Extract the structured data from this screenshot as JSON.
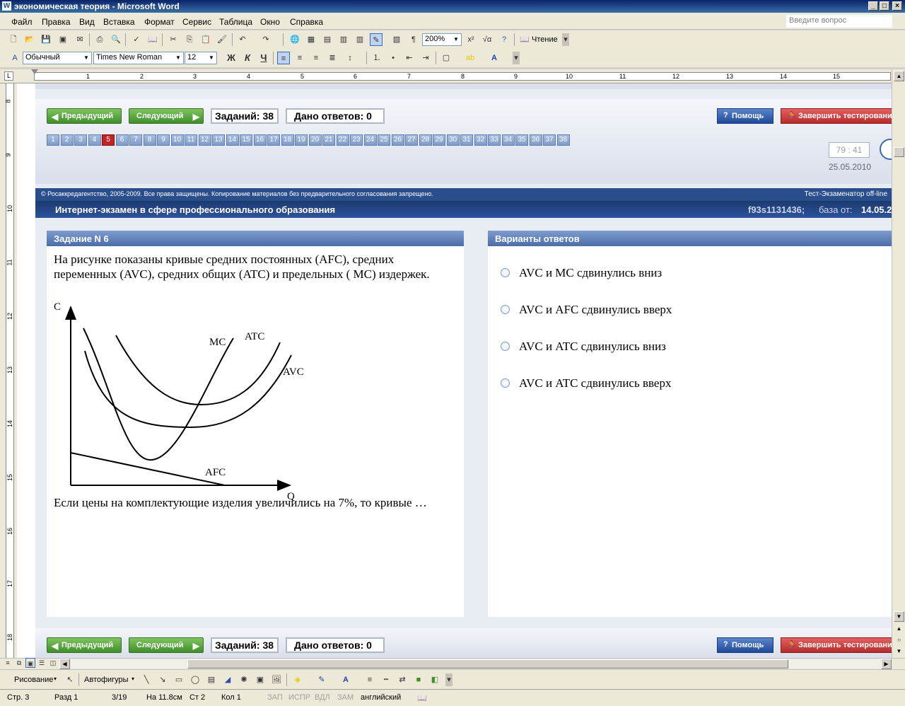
{
  "window": {
    "title": "экономическая теория - Microsoft Word"
  },
  "menu": [
    "Файл",
    "Правка",
    "Вид",
    "Вставка",
    "Формат",
    "Сервис",
    "Таблица",
    "Окно",
    "Справка"
  ],
  "ask_placeholder": "Введите вопрос",
  "toolbar": {
    "zoom": "200%",
    "reading_label": "Чтение"
  },
  "format": {
    "style": "Обычный",
    "font": "Times New Roman",
    "size": "12",
    "bold": "Ж",
    "italic": "К",
    "underline": "Ч"
  },
  "ruler": {
    "h_numbers": [
      "1",
      "2",
      "3",
      "4",
      "5",
      "6",
      "7",
      "8",
      "9",
      "10",
      "11",
      "12",
      "13",
      "14",
      "15"
    ],
    "v_numbers": [
      "8",
      "9",
      "10",
      "11",
      "12",
      "13",
      "14",
      "15",
      "16",
      "17",
      "18"
    ]
  },
  "exam": {
    "prev_label": "Предыдущий",
    "next_label": "Следующий",
    "tasks_count": "Заданий: 38",
    "answers_given": "Дано ответов: 0",
    "help_label": "Помощь",
    "finish_label": "Завершить тестирование",
    "question_numbers": [
      "1",
      "2",
      "3",
      "4",
      "5",
      "6",
      "7",
      "8",
      "9",
      "10",
      "11",
      "12",
      "13",
      "14",
      "15",
      "16",
      "17",
      "18",
      "19",
      "20",
      "21",
      "22",
      "23",
      "24",
      "25",
      "26",
      "27",
      "28",
      "29",
      "30",
      "31",
      "32",
      "33",
      "34",
      "35",
      "36",
      "37",
      "38"
    ],
    "active_question": 5,
    "timer": "79 : 41",
    "date": "25.05.2010",
    "copyright": "© Росаккредагентство, 2005-2009. Все права защищены. Копирование материалов без предварительного согласования запрещено.",
    "simulator": "Тест-Экзаменатор off-line",
    "banner_title": "Интернет-экзамен в сфере профессионального образования",
    "banner_id": "f93s1131436;",
    "banner_base_label": "база от:",
    "banner_base_date": "14.05.2",
    "task_header": "Задание N 6",
    "question_text": "На рисунке показаны кривые средних постоянных (AFC), средних переменных (AVC), средних общих (ATC) и предельных ( MC) издержек.",
    "question_tail": "Если цены на комплектующие изделия увеличились на 7%, то кривые …",
    "options_header": "Варианты ответов",
    "options": [
      "AVC и MC сдвинулись вниз",
      "AVC и AFC сдвинулись вверх",
      "AVC и ATC сдвинулись вниз",
      "AVC и ATC сдвинулись вверх"
    ],
    "graph": {
      "y_axis": "C",
      "x_axis": "Q",
      "curves": [
        "MC",
        "ATC",
        "AVC",
        "AFC"
      ]
    }
  },
  "drawing": {
    "draw_label": "Рисование",
    "autoshapes_label": "Автофигуры"
  },
  "status": {
    "page": "Стр. 3",
    "section": "Разд 1",
    "pages": "3/19",
    "at": "На 11.8см",
    "line": "Ст 2",
    "col": "Кол 1",
    "rec": "ЗАП",
    "trk": "ИСПР",
    "ext": "ВДЛ",
    "ovr": "ЗАМ",
    "lang": "английский"
  },
  "colors": {
    "active_question": "#c22424",
    "nav_green": "#3e8f2a",
    "banner_blue": "#1d3e7a"
  }
}
